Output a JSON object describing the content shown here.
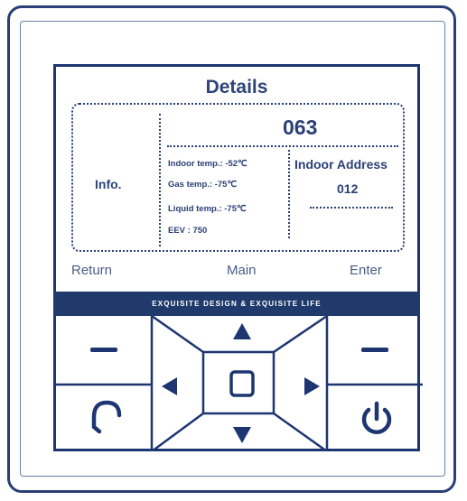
{
  "screen": {
    "title": "Details",
    "info_label": "Info.",
    "code": "063",
    "indoor_temp": "Indoor temp.: -52℃",
    "gas_temp": "Gas temp.: -75℃",
    "liquid_temp": "Liquid temp.: -75℃",
    "eev": "EEV : 750",
    "indoor_address_label": "Indoor Address",
    "indoor_address_value": "012"
  },
  "softkeys": {
    "return": "Return",
    "main": "Main",
    "enter": "Enter"
  },
  "banner": "EXQUISITE DESIGN & EXQUISITE LIFE",
  "icons": [
    "minus-icon",
    "minus-icon",
    "arrow-up-icon",
    "arrow-down-icon",
    "arrow-left-icon",
    "arrow-right-icon",
    "square-icon",
    "return-icon",
    "power-icon"
  ],
  "colors": {
    "accent": "#1d3570",
    "banner_bg": "#203a6c",
    "banner_text": "#ffffff"
  }
}
